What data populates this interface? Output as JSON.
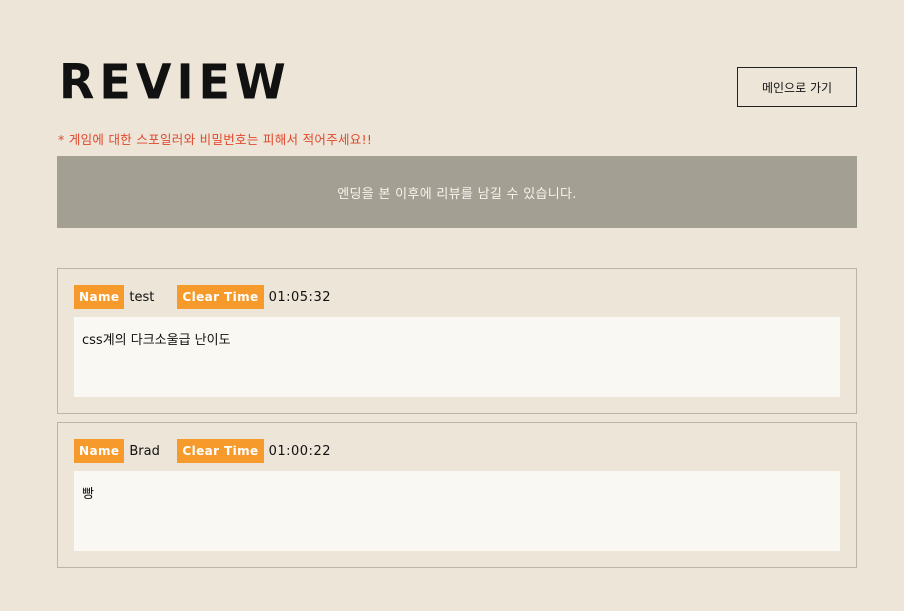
{
  "header": {
    "title": "REVIEW",
    "back_button_label": "메인으로 가기"
  },
  "warning_text": "* 게임에 대한 스포일러와 비밀번호는 피해서 적어주세요!!",
  "notice_text": "엔딩을 본 이후에 리뷰를 남길 수 있습니다.",
  "labels": {
    "name": "Name",
    "clear_time": "Clear Time"
  },
  "reviews": [
    {
      "name": "test",
      "clear_time": "01:05:32",
      "content": "css계의 다크소울급 난이도"
    },
    {
      "name": "Brad",
      "clear_time": "01:00:22",
      "content": "빵"
    }
  ],
  "colors": {
    "background": "#ece5d8",
    "notice_bg": "#a39f92",
    "tag_bg": "#f79a2c",
    "warning": "#e0482c",
    "review_body_bg": "#f9f8f3"
  }
}
